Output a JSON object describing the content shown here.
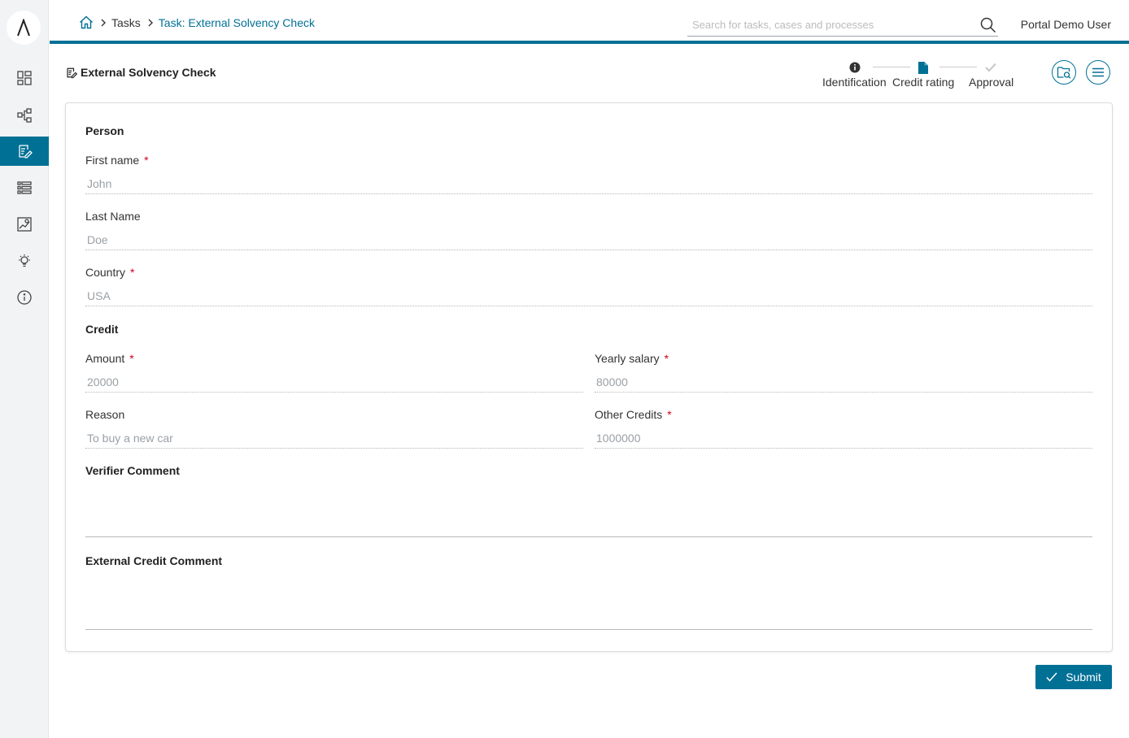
{
  "header": {
    "breadcrumb": {
      "tasks": "Tasks",
      "current": "Task: External Solvency Check"
    },
    "search_placeholder": "Search for tasks, cases and processes",
    "user": "Portal Demo User"
  },
  "task": {
    "title": "External Solvency Check"
  },
  "stepper": {
    "steps": [
      {
        "label": "Identification",
        "icon": "info-icon",
        "state": "done"
      },
      {
        "label": "Credit rating",
        "icon": "document-icon",
        "state": "current"
      },
      {
        "label": "Approval",
        "icon": "check-icon",
        "state": "pending"
      }
    ]
  },
  "sidebar": {
    "items": [
      {
        "icon": "dashboard-icon",
        "active": false
      },
      {
        "icon": "process-icon",
        "active": false
      },
      {
        "icon": "task-icon",
        "active": true
      },
      {
        "icon": "case-list-icon",
        "active": false
      },
      {
        "icon": "statistics-icon",
        "active": false
      },
      {
        "icon": "idea-icon",
        "active": false
      },
      {
        "icon": "info-icon",
        "active": false
      }
    ]
  },
  "form": {
    "person": {
      "title": "Person",
      "first_name": {
        "label": "First name",
        "value": "John",
        "required": "*"
      },
      "last_name": {
        "label": "Last Name",
        "value": "Doe"
      },
      "country": {
        "label": "Country",
        "value": "USA",
        "required": "*"
      }
    },
    "credit": {
      "title": "Credit",
      "amount": {
        "label": "Amount",
        "value": "20000",
        "required": "*"
      },
      "yearly_salary": {
        "label": "Yearly salary",
        "value": "80000",
        "required": "*"
      },
      "reason": {
        "label": "Reason",
        "value": "To buy a new car"
      },
      "other_credits": {
        "label": "Other Credits",
        "value": "1000000",
        "required": "*"
      }
    },
    "verifier_comment": {
      "title": "Verifier Comment",
      "value": ""
    },
    "external_credit_comment": {
      "title": "External Credit Comment",
      "value": ""
    }
  },
  "actions": {
    "submit": "Submit"
  },
  "colors": {
    "primary": "#007095",
    "required": "#d0021b"
  }
}
